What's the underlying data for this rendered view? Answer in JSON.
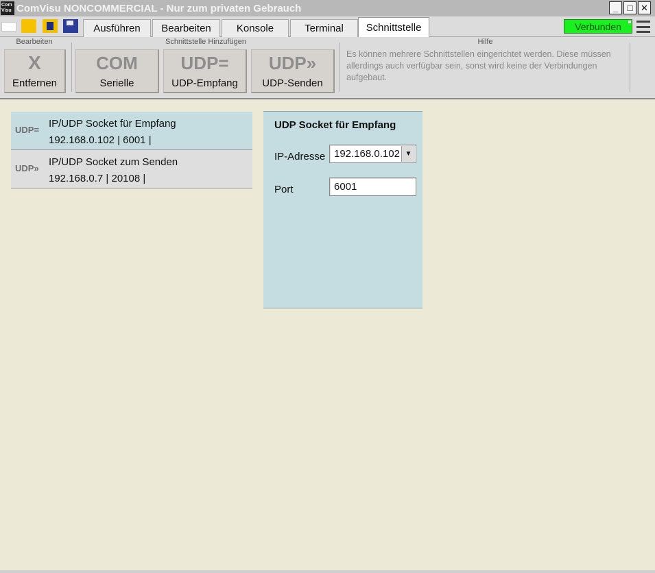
{
  "window": {
    "app_icon_text": "Com\nVisu",
    "title": "ComVisu NONCOMMERCIAL - Nur zum privaten Gebrauch",
    "minimize_glyph": "_",
    "maximize_glyph": "□",
    "close_glyph": "✕"
  },
  "quick_access": {
    "new_icon": "new-document-icon",
    "open_icon": "folder-open-icon",
    "save_icon": "save-icon",
    "save_as_icon": "save-as-icon"
  },
  "tabs": [
    {
      "label": "Ausführen"
    },
    {
      "label": "Bearbeiten"
    },
    {
      "label": "Konsole"
    },
    {
      "label": "Terminal"
    },
    {
      "label": "Schnittstelle",
      "active": true
    }
  ],
  "status": {
    "label": "Verbunden",
    "color": "#19f01e"
  },
  "ribbon": {
    "group_edit_label": "Bearbeiten",
    "group_add_label": "Schnittstelle Hinzufügen",
    "group_help_label": "Hilfe",
    "remove": {
      "glyph": "X",
      "label": "Entfernen"
    },
    "serial": {
      "glyph": "COM",
      "label": "Serielle"
    },
    "udp_receive": {
      "glyph": "UDP=",
      "label": "UDP-Empfang"
    },
    "udp_send": {
      "glyph": "UDP»",
      "label": "UDP-Senden"
    },
    "help_text": "Es können mehrere Schnittstellen eingerichtet werden. Diese müssen allerdings auch verfügbar sein, sonst wird keine der Verbindungen aufgebaut."
  },
  "interfaces": [
    {
      "icon": "UDP=",
      "title": "IP/UDP Socket für Empfang",
      "detail": "192.168.0.102 | 6001 |",
      "selected": true
    },
    {
      "icon": "UDP»",
      "title": "IP/UDP Socket zum Senden",
      "detail": "192.168.0.7 | 20108 |",
      "selected": false
    }
  ],
  "detail_panel": {
    "title": "UDP Socket für Empfang",
    "ip_label": "IP-Adresse",
    "ip_value": "192.168.0.102",
    "port_label": "Port",
    "port_value": "6001"
  },
  "colors": {
    "background": "#ece9d6",
    "selected_row": "#c5dde0",
    "status_ok": "#19f01e"
  }
}
